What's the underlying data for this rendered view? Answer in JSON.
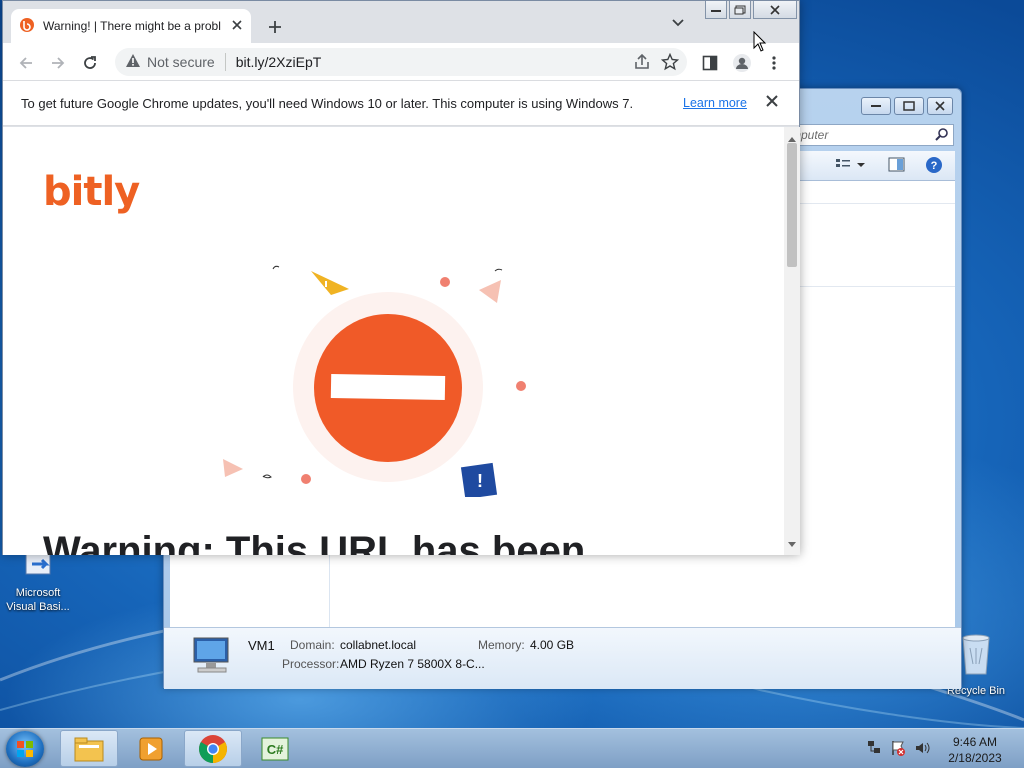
{
  "desktop": {
    "icons": [
      {
        "label": "Microsoft Visual Basi...",
        "icon": "visual-basic-shortcut-icon"
      },
      {
        "label": "Recycle Bin",
        "icon": "recycle-bin-icon"
      }
    ]
  },
  "explorer": {
    "search_placeholder": "mputer",
    "details": {
      "name": "VM1",
      "domain_label": "Domain:",
      "domain_value": "collabnet.local",
      "memory_label": "Memory:",
      "memory_value": "4.00 GB",
      "processor_label": "Processor:",
      "processor_value": "AMD Ryzen 7 5800X 8-C..."
    }
  },
  "chrome": {
    "tab_title": "Warning! | There might be a probl",
    "omnibox": {
      "security_label": "Not secure",
      "url": "bit.ly/2XziEpT"
    },
    "infobar": {
      "message": "To get future Google Chrome updates, you'll need Windows 10 or later. This computer is using Windows 7.",
      "link": "Learn more"
    },
    "page": {
      "logo_text": "bitly",
      "heading": "Warning: This URL has been"
    }
  },
  "taskbar": {
    "apps": [
      "windows-explorer-icon",
      "media-player-icon",
      "chrome-icon",
      "csharp-icon"
    ],
    "clock_time": "9:46 AM",
    "clock_date": "2/18/2023"
  },
  "colors": {
    "bitly_orange": "#ee6123",
    "stop_red": "#f05a28",
    "link_blue": "#1a73e8"
  }
}
